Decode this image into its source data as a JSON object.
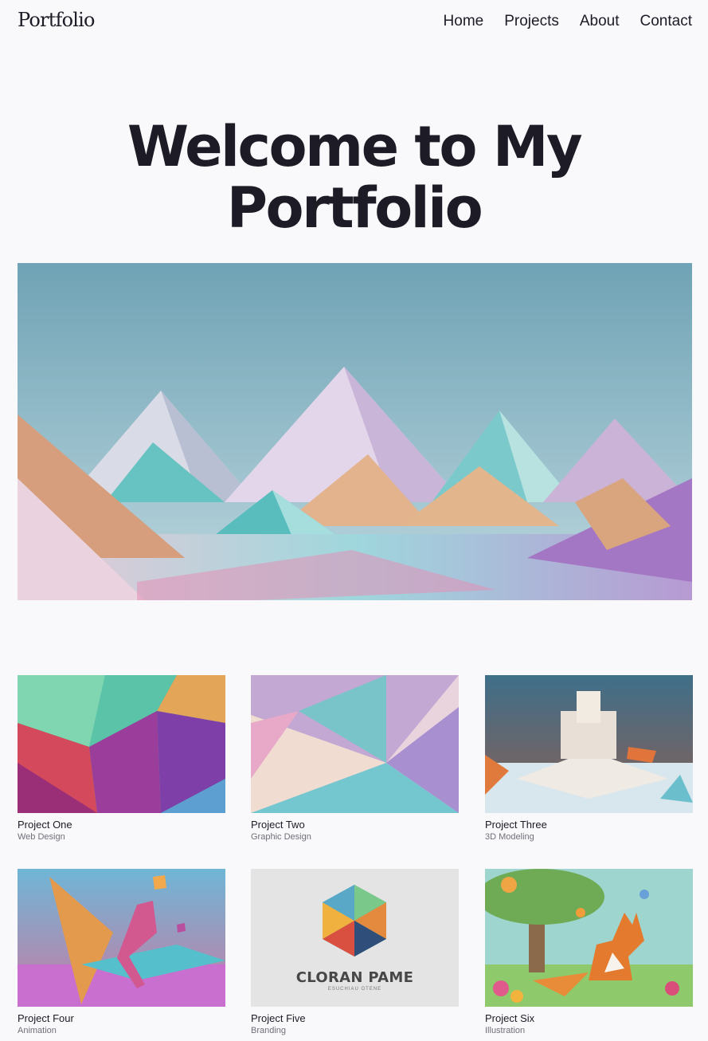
{
  "header": {
    "logo": "Portfolio",
    "nav": [
      "Home",
      "Projects",
      "About",
      "Contact"
    ]
  },
  "hero": {
    "title_line1": "Welcome to My",
    "title_line2": "Portfolio",
    "image_alt": "low-poly pastel mountain landscape"
  },
  "projects": [
    {
      "title": "Project One",
      "category": "Web Design",
      "image": "colorful-polygon-abstract"
    },
    {
      "title": "Project Two",
      "category": "Graphic Design",
      "image": "pastel-triangle-abstract"
    },
    {
      "title": "Project Three",
      "category": "3D Modeling",
      "image": "low-poly-castle"
    },
    {
      "title": "Project Four",
      "category": "Animation",
      "image": "low-poly-runner"
    },
    {
      "title": "Project Five",
      "category": "Branding",
      "image": "hexagon-logo",
      "logo_text": "CLORAN PAME",
      "logo_subtext": "ESUCHIAU OTENE"
    },
    {
      "title": "Project Six",
      "category": "Illustration",
      "image": "fox-in-garden"
    }
  ],
  "colors": {
    "background": "#f9f9fb",
    "text": "#1c1b26",
    "muted": "#6f6f7a"
  }
}
